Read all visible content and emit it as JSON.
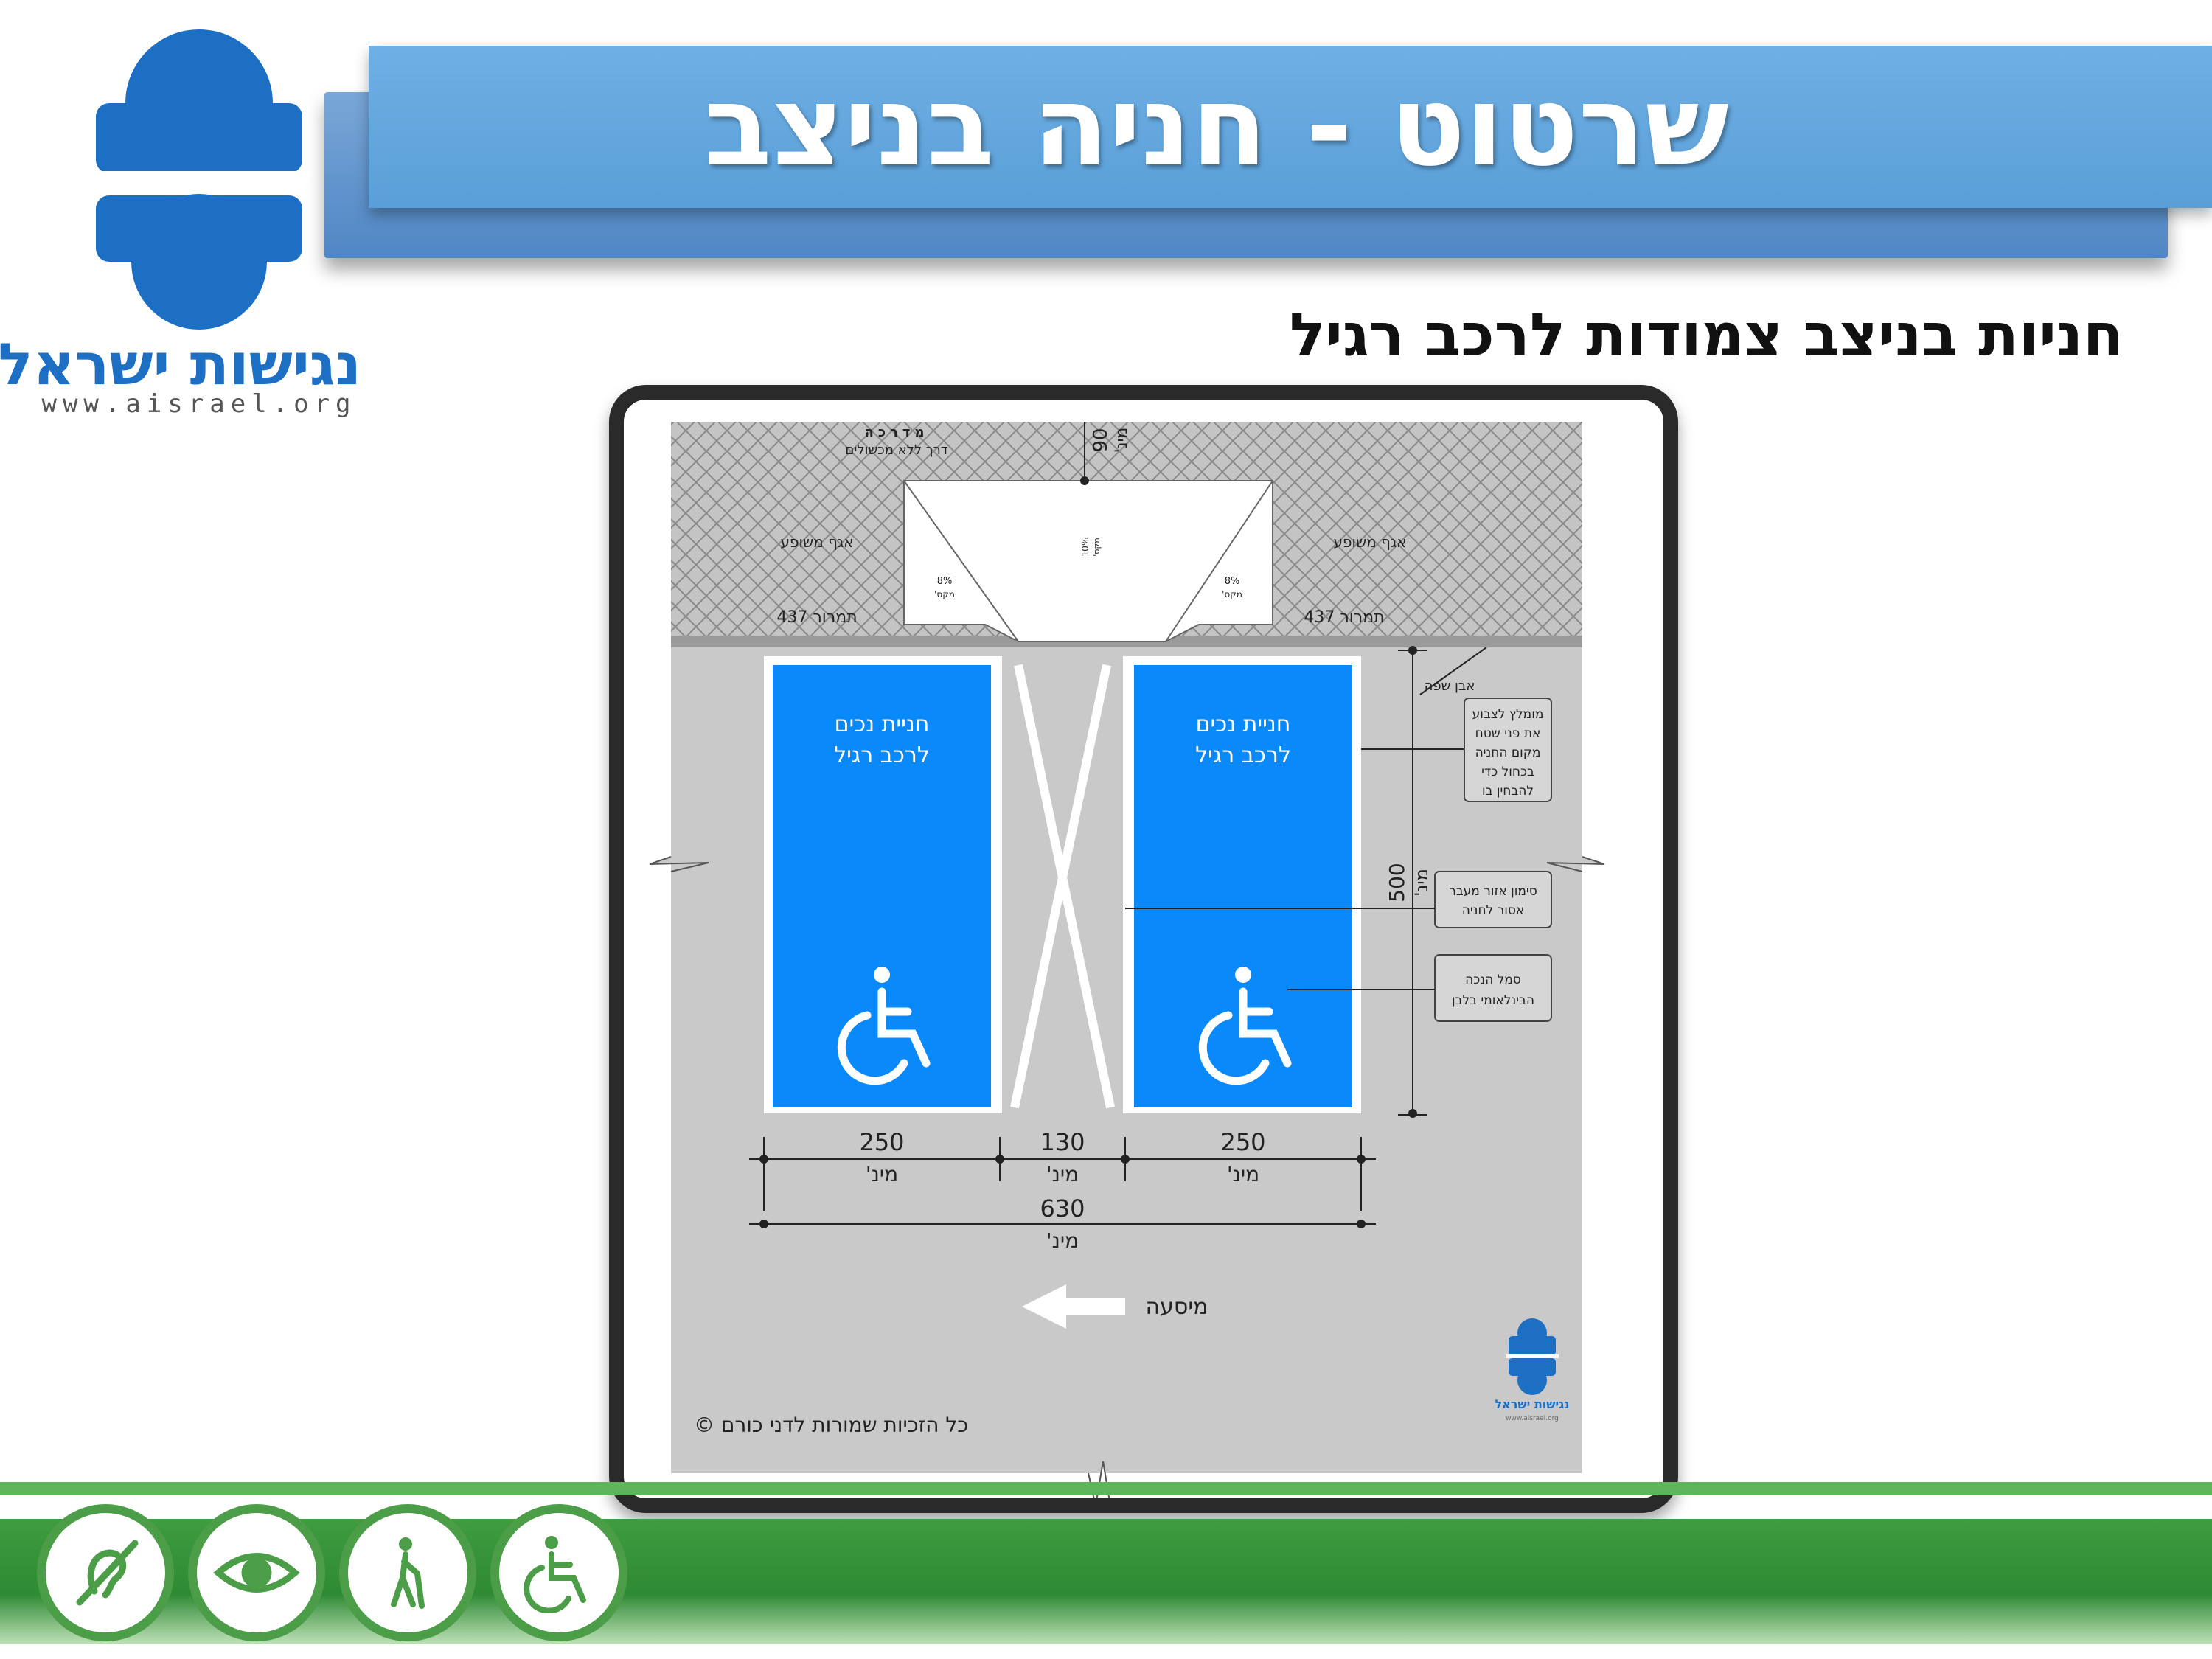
{
  "header": {
    "title": "שרטוט - חניה בניצב",
    "subtitle": "חניות בניצב צמודות לרכב רגיל"
  },
  "logo": {
    "name": "נגישות ישראל",
    "url": "www.aisrael.org"
  },
  "diagram": {
    "sidewalk": {
      "title": "מדרכה",
      "subtitle": "דרך ללא מכשולים",
      "top_depth_value": "90",
      "top_depth_unit": "מינ'"
    },
    "ramp": {
      "slope_center": "10%",
      "slope_center_note": "מקס'",
      "slope_side": "8%",
      "slope_side_note": "מקס'",
      "flank_label": "אגף משופע",
      "sign_label": "תמרור 437"
    },
    "curb_label": "אבן שפה",
    "spaces": [
      {
        "line1": "חניית נכים",
        "line2": "לרכב רגיל"
      },
      {
        "line1": "חניית נכים",
        "line2": "לרכב רגיל"
      }
    ],
    "callouts": {
      "paint": [
        "מומלץ לצבוע",
        "את פני שטח",
        "מקום החניה",
        "בכחול כדי",
        "להבחין בו"
      ],
      "hatch": [
        "סימון אזור מעבר",
        "אסור לחניה"
      ],
      "symbol": [
        "סמל הנכה",
        "הבינלאומי בלבן"
      ]
    },
    "depth_value": "500",
    "depth_unit": "מינ'",
    "dims": [
      {
        "value": "250",
        "unit": "מינ'"
      },
      {
        "value": "130",
        "unit": "מינ'"
      },
      {
        "value": "250",
        "unit": "מינ'"
      }
    ],
    "total_dim": {
      "value": "630",
      "unit": "מינ'"
    },
    "travel_label": "מיסעה",
    "copyright": "©  כל הזכיות שמורות לדני כורם",
    "mini_logo_name": "נגישות ישראל",
    "mini_logo_url": "www.aisrael.org"
  },
  "colors": {
    "title_bar": "#62a6de",
    "logo_blue": "#1d6fc4",
    "parking_blue": "#0a89fa",
    "asphalt": "#c9c9c9",
    "footer_green": "#3f9c3f"
  },
  "footer_icons": [
    "hearing-icon",
    "vision-icon",
    "walking-cane-icon",
    "wheelchair-icon"
  ]
}
